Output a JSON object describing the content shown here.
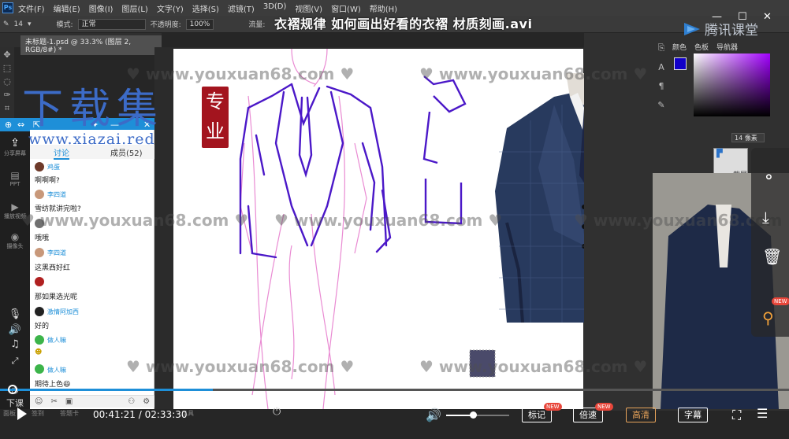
{
  "video": {
    "title": "衣褶规律 如何画出好看的衣褶 材质刻画.avi",
    "current_time": "00:41:21",
    "separator": "/",
    "duration": "02:33:30",
    "progress": 0.27,
    "volume": 0.42
  },
  "brand": {
    "name": "腾讯课堂"
  },
  "photoshop": {
    "logo": "Ps",
    "menu": [
      "文件(F)",
      "编辑(E)",
      "图像(I)",
      "图层(L)",
      "文字(Y)",
      "选择(S)",
      "滤镜(T)",
      "3D(D)",
      "视图(V)",
      "窗口(W)",
      "帮助(H)"
    ],
    "options": {
      "size": "14",
      "mode_label": "模式:",
      "mode_value": "正常",
      "opacity_label": "不透明度:",
      "opacity_value": "100%",
      "flow_label": "流量:"
    },
    "document_tab": "未标题-1.psd @ 33.3% (图层 2, RGB/8#) *",
    "panel_tabs": [
      "颜色",
      "色板",
      "导航器"
    ],
    "brush_size_field": "14 像素",
    "layer_label": "截屏"
  },
  "chat": {
    "tabs": [
      "讨论",
      "成员(52)"
    ],
    "messages": [
      {
        "name": "鸡蛋",
        "text": "啊啊啊?"
      },
      {
        "name": "李四道",
        "text": "雪纺就讲完啦?"
      },
      {
        "name": "",
        "text": "哦哦"
      },
      {
        "name": "李四道",
        "text": "这黑西好红"
      },
      {
        "name": "",
        "text": "那如果选光呢"
      },
      {
        "name": "激情阿加西",
        "text": "好的"
      },
      {
        "name": "做人嘛",
        "text": ""
      },
      {
        "name": "做人嘛",
        "text": "期待上色"
      }
    ],
    "emoji_end": "😆"
  },
  "left_bar": {
    "items": [
      "分享屏幕",
      "PPT",
      "播放视频",
      "摄像头",
      "下课"
    ],
    "bottom_labels": [
      "面板",
      "签到",
      "答题卡",
      "工具"
    ]
  },
  "watermarks": {
    "site": "♥ www.youxuan68.com ♥",
    "big_title": "下载集",
    "seal": "专业",
    "url": "www.xiazai.red"
  },
  "player_buttons": [
    {
      "label": "标记",
      "badge": "NEW"
    },
    {
      "label": "倍速",
      "badge": "NEW"
    },
    {
      "label": "高清",
      "badge": ""
    },
    {
      "label": "字幕",
      "badge": ""
    }
  ],
  "float_actions": {
    "pin_badge": "NEW"
  },
  "colors": {
    "accent": "#1e8fd8",
    "hd_active": "#e7a35a",
    "seal_red": "#a3141e",
    "xz_blue": "#3c6bc7"
  }
}
